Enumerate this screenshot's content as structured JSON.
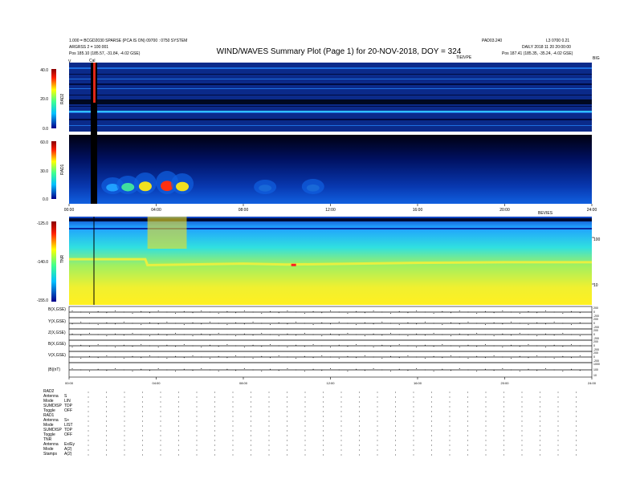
{
  "header": {
    "title": "WIND/WAVES Summary Plot (Page 1) for 20-NOV-2018, DOY = 324",
    "left_line1": "1.000 = BCGD2030 SPARSE (PCA IS ON) 09700 : 0750 SYSTEM",
    "left_line2": "ARGRSS 2 = 100:001",
    "left_line3": "Pos   185.10 (185.57, -31.84, -4.02 GSE)",
    "right_top": "PAD03.240",
    "right_top2": "L3 0700 0.21",
    "right_line2": "DAILY 2018 11 20 20:00:00",
    "right_line3": "Pos   187.41 (185.35, -35.24, -4.02 GSE)",
    "center_small": "TIEIVPE",
    "corner_v": "V",
    "corner_cal": "Cal"
  },
  "colors": {
    "spectrogram_background": "#0b2a8a",
    "trace": "#000000",
    "cal_bar": "#000000",
    "cal_marker": "#e02818",
    "colorbar_top": "#8b0000",
    "colorbar_mid": "#ffff00",
    "colorbar_low": "#00c0ff",
    "colorbar_bottom": "#00008b"
  },
  "chart_data": [
    {
      "type": "heatmap",
      "panel": "RAD2",
      "ylabel": "RAD2",
      "y_ticks": [
        "40.0",
        "20.0",
        "0.0"
      ],
      "ylim": [
        0,
        40
      ],
      "xlim": [
        0,
        24
      ],
      "right_label": "BIG"
    },
    {
      "type": "heatmap",
      "panel": "RAD1",
      "ylabel": "RAD1",
      "y_ticks": [
        "60.0",
        "30.0",
        "0.0"
      ],
      "ylim": [
        0,
        60
      ],
      "xlim": [
        0,
        24
      ],
      "x_ticks": [
        "00:00",
        "04:00",
        "08:00",
        "12:00",
        "16:00",
        "20:00",
        "24:00"
      ],
      "right_label": "BEVIES",
      "intensity_by_hour": [
        {
          "hour": 2.0,
          "level": 0.45
        },
        {
          "hour": 2.7,
          "level": 0.55
        },
        {
          "hour": 3.5,
          "level": 0.75
        },
        {
          "hour": 4.5,
          "level": 0.85
        },
        {
          "hour": 5.2,
          "level": 0.7
        },
        {
          "hour": 9.0,
          "level": 0.3
        },
        {
          "hour": 11.2,
          "level": 0.35
        }
      ]
    },
    {
      "type": "heatmap",
      "panel": "TNR",
      "ylabel": "TNR",
      "y_ticks": [
        "-125.0",
        "-140.0",
        "-155.0"
      ],
      "ylim": [
        -155,
        -125
      ],
      "xlim": [
        0,
        24
      ],
      "right_ticks": [
        "100",
        "10"
      ],
      "band_level": [
        {
          "hour": 0,
          "value": -139.5
        },
        {
          "hour": 3.5,
          "value": -139.5
        },
        {
          "hour": 3.6,
          "value": -141.5
        },
        {
          "hour": 8,
          "value": -141.0
        },
        {
          "hour": 10,
          "value": -141.3
        },
        {
          "hour": 16,
          "value": -140.7
        },
        {
          "hour": 20,
          "value": -140.5
        },
        {
          "hour": 24,
          "value": -140.5
        }
      ]
    },
    {
      "type": "line",
      "panels": [
        {
          "label": "B(X,GSE)",
          "right_ticks": [
            "200",
            "0",
            "-200"
          ]
        },
        {
          "label": "Y(X,GSE)",
          "right_ticks": [
            "200",
            "0",
            "-200"
          ]
        },
        {
          "label": "Z(X,GSE)",
          "right_ticks": [
            "200",
            "0",
            "-200"
          ]
        },
        {
          "label": "B(X,GSE)",
          "right_ticks": [
            "200",
            "0",
            "-200"
          ]
        },
        {
          "label": "V(X,GSE)",
          "right_ticks": [
            "200",
            "0",
            "-200"
          ]
        },
        {
          "label": "|B|(nT)",
          "right_ticks": [
            "1000",
            "100",
            "10"
          ]
        }
      ],
      "x_ticks": [
        "00:00",
        "04:00",
        "08:00",
        "12:00",
        "16:00",
        "20:00",
        "24:00"
      ],
      "xlim": [
        0,
        24
      ]
    }
  ],
  "footer": {
    "rad2_title": "RAD2",
    "rad2_rows": [
      {
        "label": "Antenna",
        "value": "S"
      },
      {
        "label": "Mode",
        "value": "LIN"
      },
      {
        "label": "SUMDISP",
        "value": "TDP"
      },
      {
        "label": "Toggle",
        "value": "OFF"
      }
    ],
    "rad1_title": "RAD1",
    "rad1_rows": [
      {
        "label": "Antenna",
        "value": "S+"
      },
      {
        "label": "Mode",
        "value": "LIST"
      },
      {
        "label": "SUMDISP",
        "value": "TDP"
      },
      {
        "label": "Toggle",
        "value": "OFF"
      }
    ],
    "tnr_title": "TNR",
    "tnr_rows": [
      {
        "label": "Antenna",
        "value": "Ex/Ey"
      },
      {
        "label": "Mode",
        "value": "A(2)"
      },
      {
        "label": "Stamps",
        "value": "A(2)"
      }
    ]
  }
}
